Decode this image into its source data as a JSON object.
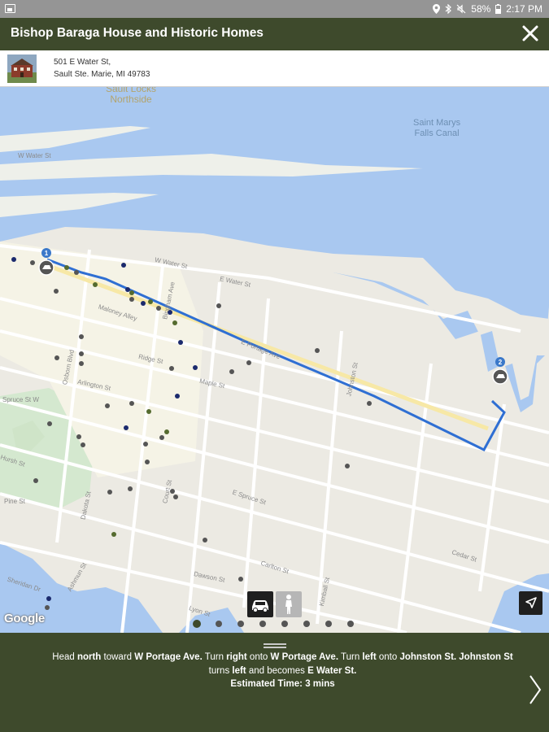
{
  "status_bar": {
    "battery": "58%",
    "time": "2:17 PM"
  },
  "header": {
    "title": "Bishop Baraga House and Historic Homes"
  },
  "address": {
    "line1": "501 E Water St,",
    "line2": "Sault Ste. Marie, MI 49783"
  },
  "map": {
    "area_label": "Sault Locks\nNorthside",
    "water_label": "Saint Marys\nFalls Canal",
    "markers": [
      "1",
      "2"
    ],
    "streets": [
      "W Water St",
      "W Water St",
      "E Water St",
      "Maloney Alley",
      "Bingham Ave",
      "Ridge St",
      "Arlington St",
      "Spruce St W",
      "Maple St",
      "Johnston St",
      "E Portage Ave",
      "Ashmun St",
      "Osborn Blvd",
      "Dawson St",
      "Court St",
      "Dakota St",
      "E Spruce St",
      "Carlton St",
      "Kimball St",
      "Cedar St",
      "Lyon St",
      "Sheridan Dr",
      "Pine St",
      "Hursh St"
    ],
    "brand": "Google",
    "travel_modes": [
      "car",
      "walk"
    ],
    "selected_mode": "car"
  },
  "pager": {
    "count": 8,
    "active_index": 0
  },
  "directions": {
    "segments": [
      {
        "text": "Head ",
        "bold": false
      },
      {
        "text": "north",
        "bold": true
      },
      {
        "text": " toward ",
        "bold": false
      },
      {
        "text": "W Portage Ave.",
        "bold": true
      },
      {
        "text": " Turn ",
        "bold": false
      },
      {
        "text": "right",
        "bold": true
      },
      {
        "text": " onto ",
        "bold": false
      },
      {
        "text": "W Portage Ave.",
        "bold": true
      },
      {
        "text": " Turn ",
        "bold": false
      },
      {
        "text": "left",
        "bold": true
      },
      {
        "text": " onto ",
        "bold": false
      },
      {
        "text": "Johnston St. Johnston St",
        "bold": true
      },
      {
        "text": " turns ",
        "bold": false
      },
      {
        "text": "left",
        "bold": true
      },
      {
        "text": " and becomes ",
        "bold": false
      },
      {
        "text": "E Water St.",
        "bold": true
      }
    ],
    "estimated_time": "Estimated Time: 3 mins"
  },
  "colors": {
    "header_bg": "#3e4a2c",
    "water": "#a9c8f0",
    "route": "#2f6fd3",
    "marker": "#3a78c9"
  }
}
